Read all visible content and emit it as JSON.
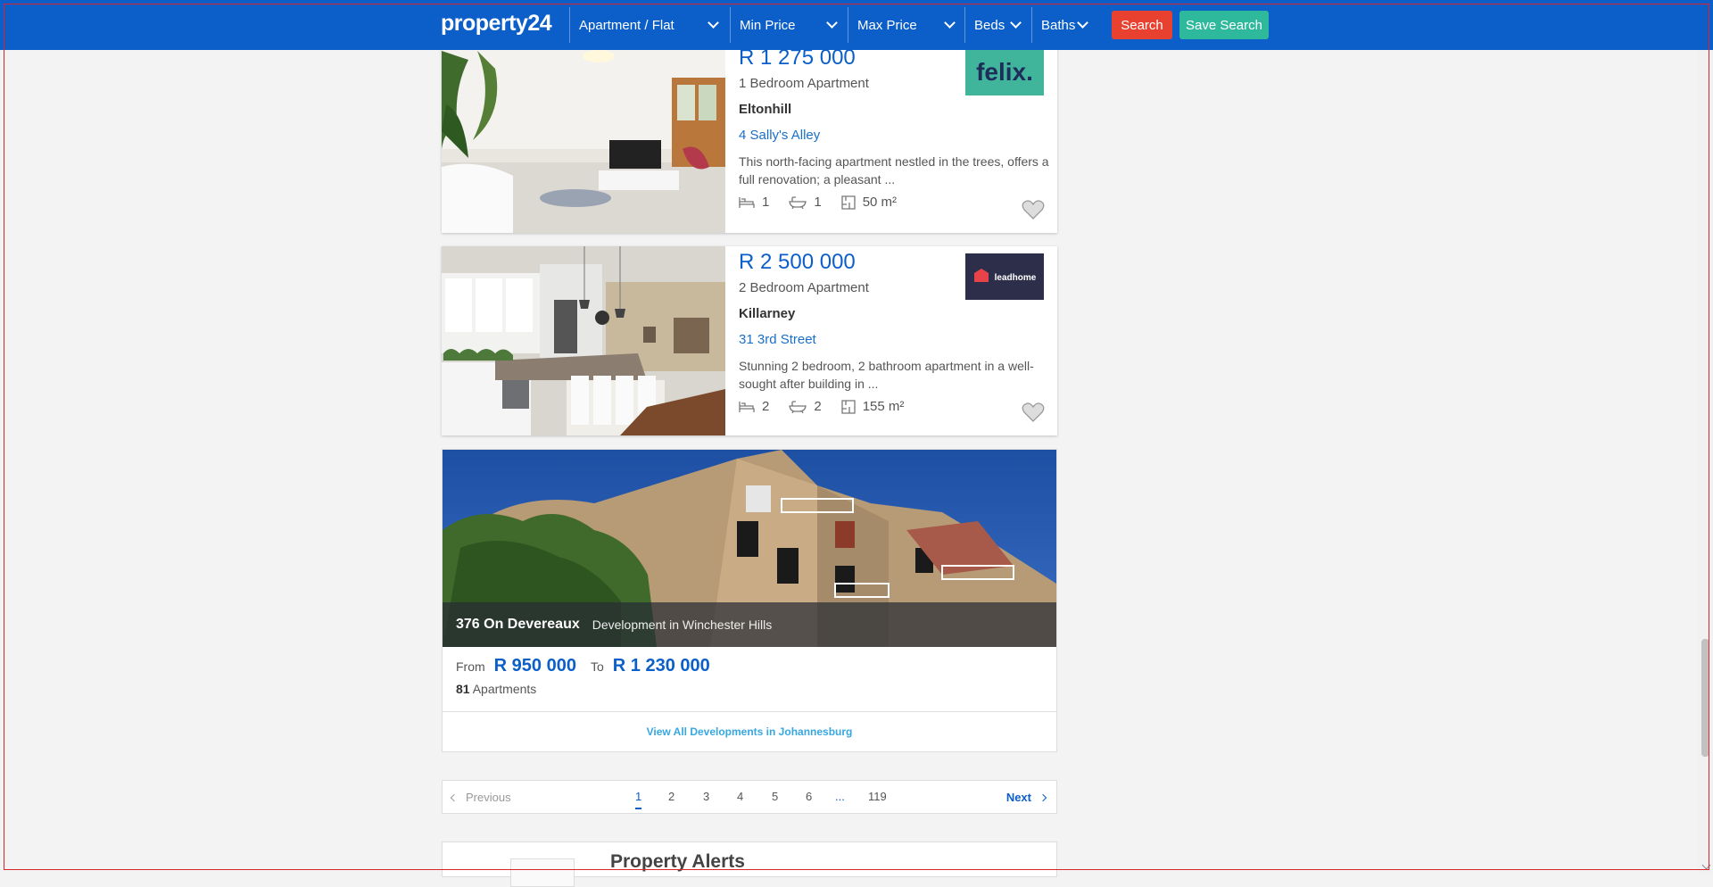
{
  "header": {
    "logo": "property24",
    "property_type": "Apartment / Flat",
    "min_price": "Min Price",
    "max_price": "Max Price",
    "beds": "Beds",
    "baths": "Baths",
    "search_label": "Search",
    "save_search_label": "Save Search",
    "colors": {
      "bar": "#0c5fc9",
      "search": "#e8412f",
      "save": "#2fb99c"
    }
  },
  "listings": [
    {
      "price": "R 1 275 000",
      "type": "1 Bedroom Apartment",
      "suburb": "Eltonhill",
      "street": "4 Sally's Alley",
      "description": "This north-facing apartment nestled in the trees, offers a full renovation; a pleasant ...",
      "beds": "1",
      "baths": "1",
      "size": "50 m²",
      "agent": "felix."
    },
    {
      "price": "R 2 500 000",
      "type": "2 Bedroom Apartment",
      "suburb": "Killarney",
      "street": "31 3rd Street",
      "description": "Stunning 2 bedroom, 2 bathroom apartment in a well-sought after building in ...",
      "beds": "2",
      "baths": "2",
      "size": "155 m²",
      "agent": "leadhome"
    }
  ],
  "development": {
    "name": "376 On Devereaux",
    "subtitle": "Development in Winchester Hills",
    "from_label": "From",
    "from_price": "R 950 000",
    "to_label": "To",
    "to_price": "R 1 230 000",
    "unit_count": "81",
    "unit_label": "Apartments",
    "view_all": "View All Developments in Johannesburg"
  },
  "pagination": {
    "previous": "Previous",
    "next": "Next",
    "pages": [
      "1",
      "2",
      "3",
      "4",
      "5",
      "6",
      "...",
      "119"
    ],
    "current": "1"
  },
  "alerts": {
    "title": "Property Alerts"
  }
}
